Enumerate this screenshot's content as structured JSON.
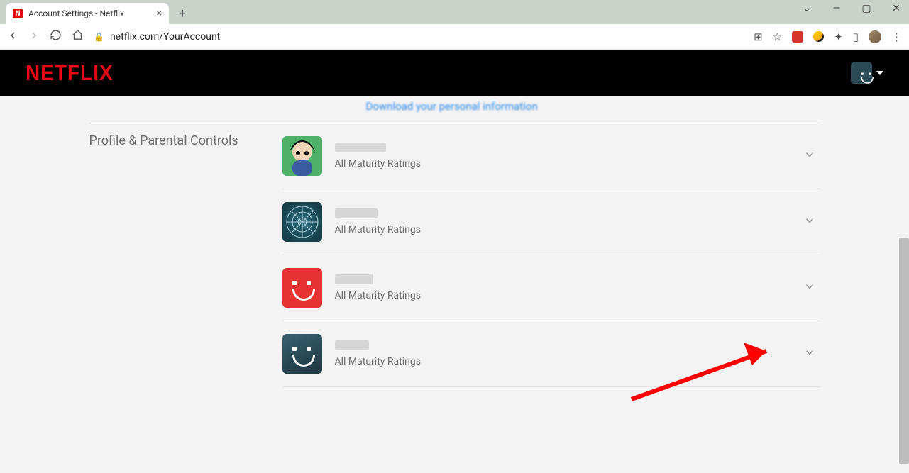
{
  "browser": {
    "tab_title": "Account Settings - Netflix",
    "url": "netflix.com/YourAccount"
  },
  "header": {
    "logo_text": "NETFLIX"
  },
  "page": {
    "partial_link": "Download your personal information",
    "section_title": "Profile & Parental Controls",
    "profiles": [
      {
        "rating": "All Maturity Ratings",
        "avatar": "character-green"
      },
      {
        "rating": "All Maturity Ratings",
        "avatar": "mandala-blue"
      },
      {
        "rating": "All Maturity Ratings",
        "avatar": "smile-red"
      },
      {
        "rating": "All Maturity Ratings",
        "avatar": "smile-teal"
      }
    ]
  }
}
